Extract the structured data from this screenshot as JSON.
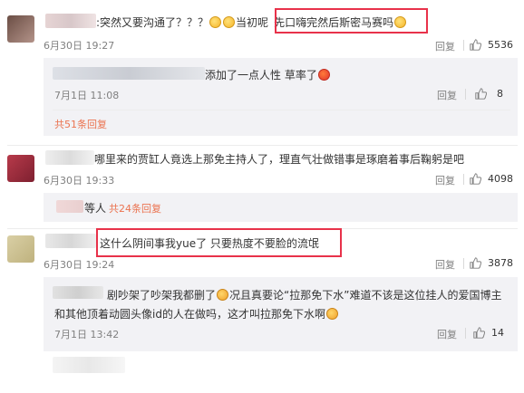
{
  "comments": [
    {
      "text": ":突然又要沟通了？？？",
      "text_after_emoji": "当初呢",
      "highlighted_text": "先口嗨完然后斯密马赛吗",
      "date": "6月30日 19:27",
      "reply_label": "回复",
      "likes": "5536",
      "replies": [
        {
          "text": "添加了一点人性 草率了",
          "date": "7月1日 11:08",
          "reply_label": "回复",
          "likes": "8"
        }
      ],
      "more_replies": "共51条回复"
    },
    {
      "text": "哪里来的贾缸人竟选上那免主持人了，理直气壮做错事是琢磨着事后鞠躬是吧",
      "date": "6月30日 19:33",
      "reply_label": "回复",
      "likes": "4098",
      "reply_suffix": "等人",
      "more_replies": "共24条回复"
    },
    {
      "highlighted_text": "这什么阴间事我yue了 只要热度不要脸的流氓",
      "date": "6月30日 19:24",
      "reply_label": "回复",
      "likes": "3878",
      "replies": [
        {
          "text_line1": "剧吵架了吵架我都删了",
          "text_line1b": "况且真要论“拉那免下水”难道不该是这位挂人的爱国博主",
          "text_line2": "和其他顶着动圆头像id的人在做吗，这才叫拉那免下水啊",
          "date": "7月1日 13:42",
          "reply_label": "回复",
          "likes": "14"
        }
      ]
    }
  ],
  "icons": {
    "like": "thumbs-up-icon",
    "emoji_sweat": "sweat-smile-emoji",
    "emoji_angry": "angry-emoji",
    "emoji_sad": "sad-emoji"
  },
  "colors": {
    "highlight_box": "#e8324a",
    "link_orange": "#eb7350",
    "meta_gray": "#808080",
    "reply_bg": "#f2f2f5"
  }
}
